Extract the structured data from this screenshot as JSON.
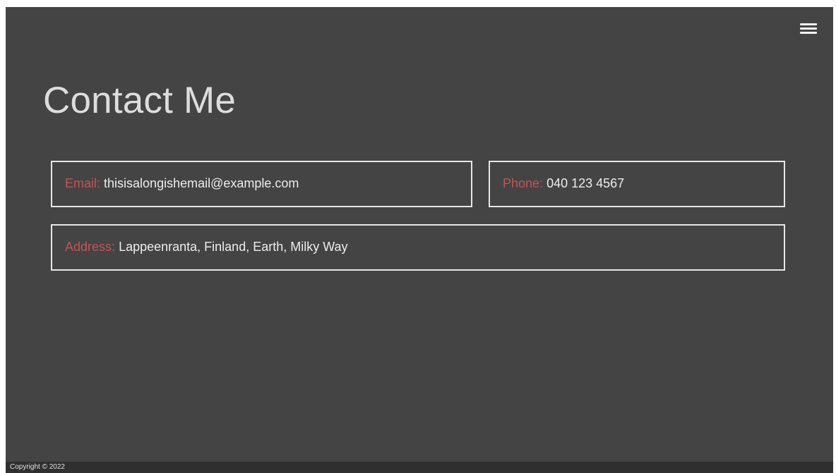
{
  "header": {
    "menu_icon": "hamburger-menu-icon"
  },
  "main": {
    "title": "Contact Me",
    "contact": {
      "email_label": "Email:",
      "email_value": "thisisalongishemail@example.com",
      "phone_label": "Phone:",
      "phone_value": "040 123 4567",
      "address_label": "Address:",
      "address_value": "Lappeenranta, Finland, Earth, Milky Way"
    }
  },
  "footer": {
    "copyright": "Copyright © 2022"
  },
  "colors": {
    "background": "#444444",
    "label_accent": "#c25454",
    "text": "#e8e8e8",
    "border": "#e6e6e6"
  }
}
